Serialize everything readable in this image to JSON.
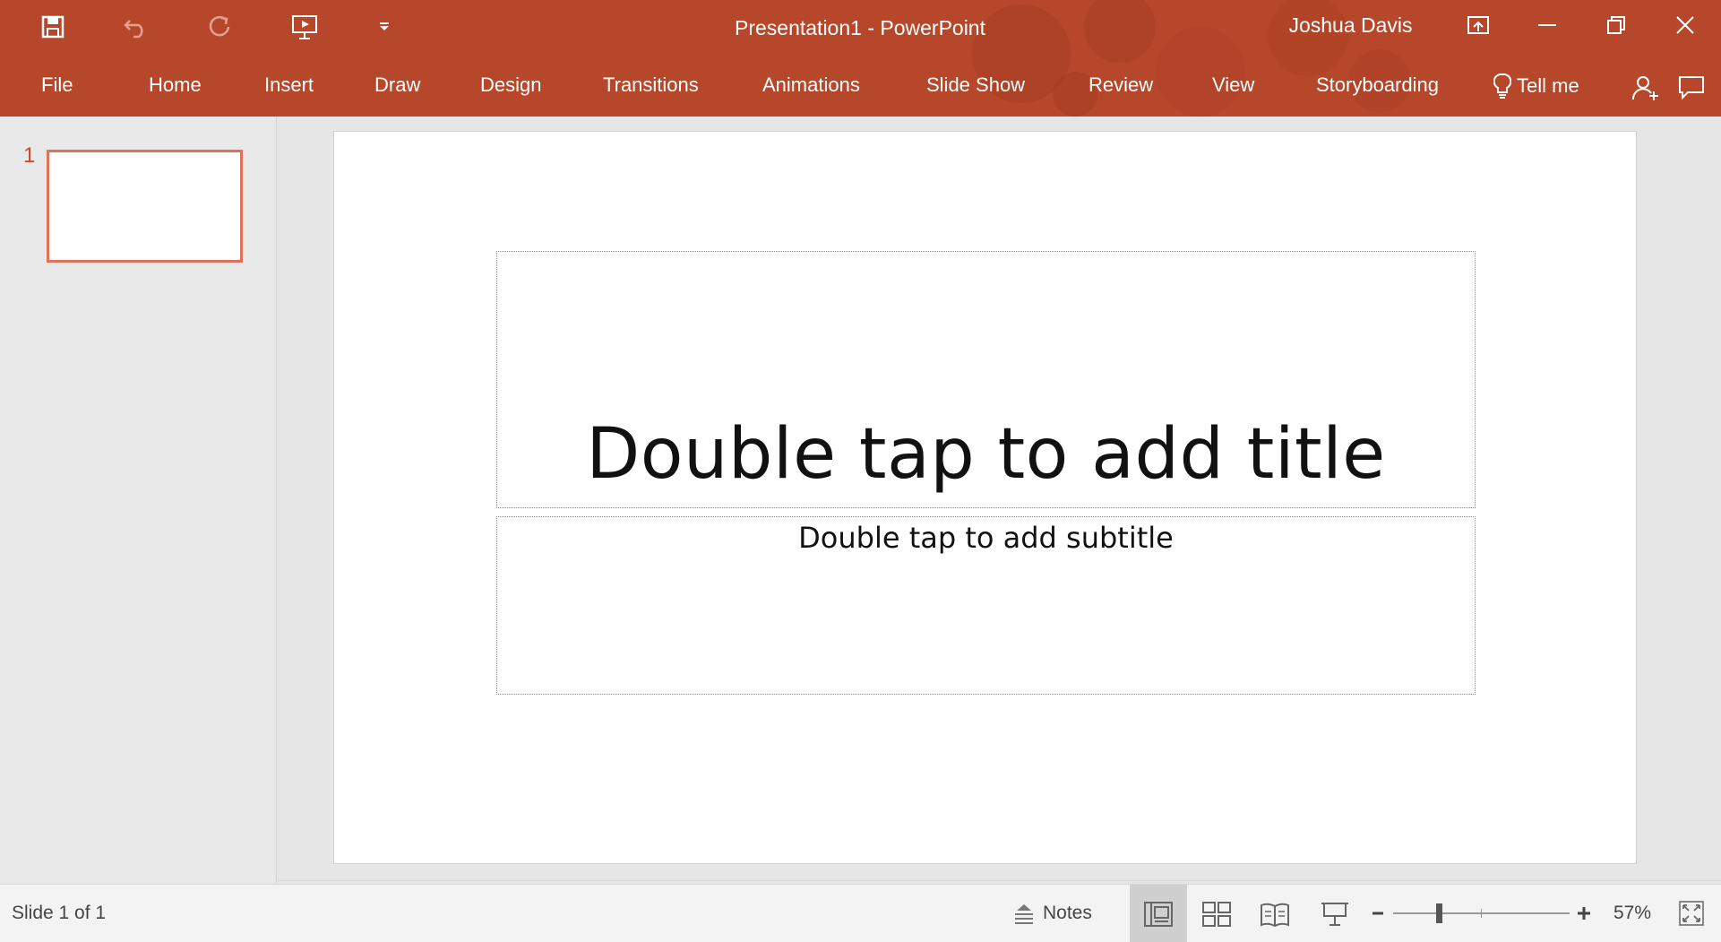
{
  "window": {
    "title": "Presentation1 - PowerPoint",
    "user": "Joshua Davis"
  },
  "quick_access": [
    {
      "name": "save",
      "icon": "save-icon"
    },
    {
      "name": "undo",
      "icon": "undo-icon"
    },
    {
      "name": "redo",
      "icon": "redo-icon"
    },
    {
      "name": "present",
      "icon": "present-from-beginning-icon"
    },
    {
      "name": "customize",
      "icon": "chevron-down-icon"
    }
  ],
  "ribbon": {
    "tabs": [
      "File",
      "Home",
      "Insert",
      "Draw",
      "Design",
      "Transitions",
      "Animations",
      "Slide Show",
      "Review",
      "View",
      "Storyboarding"
    ],
    "tell_me": "Tell me",
    "icons": [
      "lightbulb-icon",
      "share-icon",
      "comments-icon"
    ]
  },
  "thumbnails": [
    {
      "number": "1",
      "selected": true
    }
  ],
  "slide": {
    "title_placeholder": "Double tap to add title",
    "subtitle_placeholder": "Double tap to add subtitle"
  },
  "status": {
    "slide_info": "Slide 1 of 1",
    "notes_label": "Notes",
    "zoom_level": "57%",
    "zoom_percent": 57,
    "active_view": "normal"
  },
  "colors": {
    "accent": "#b7472a",
    "thumb_border": "#e0715b"
  }
}
